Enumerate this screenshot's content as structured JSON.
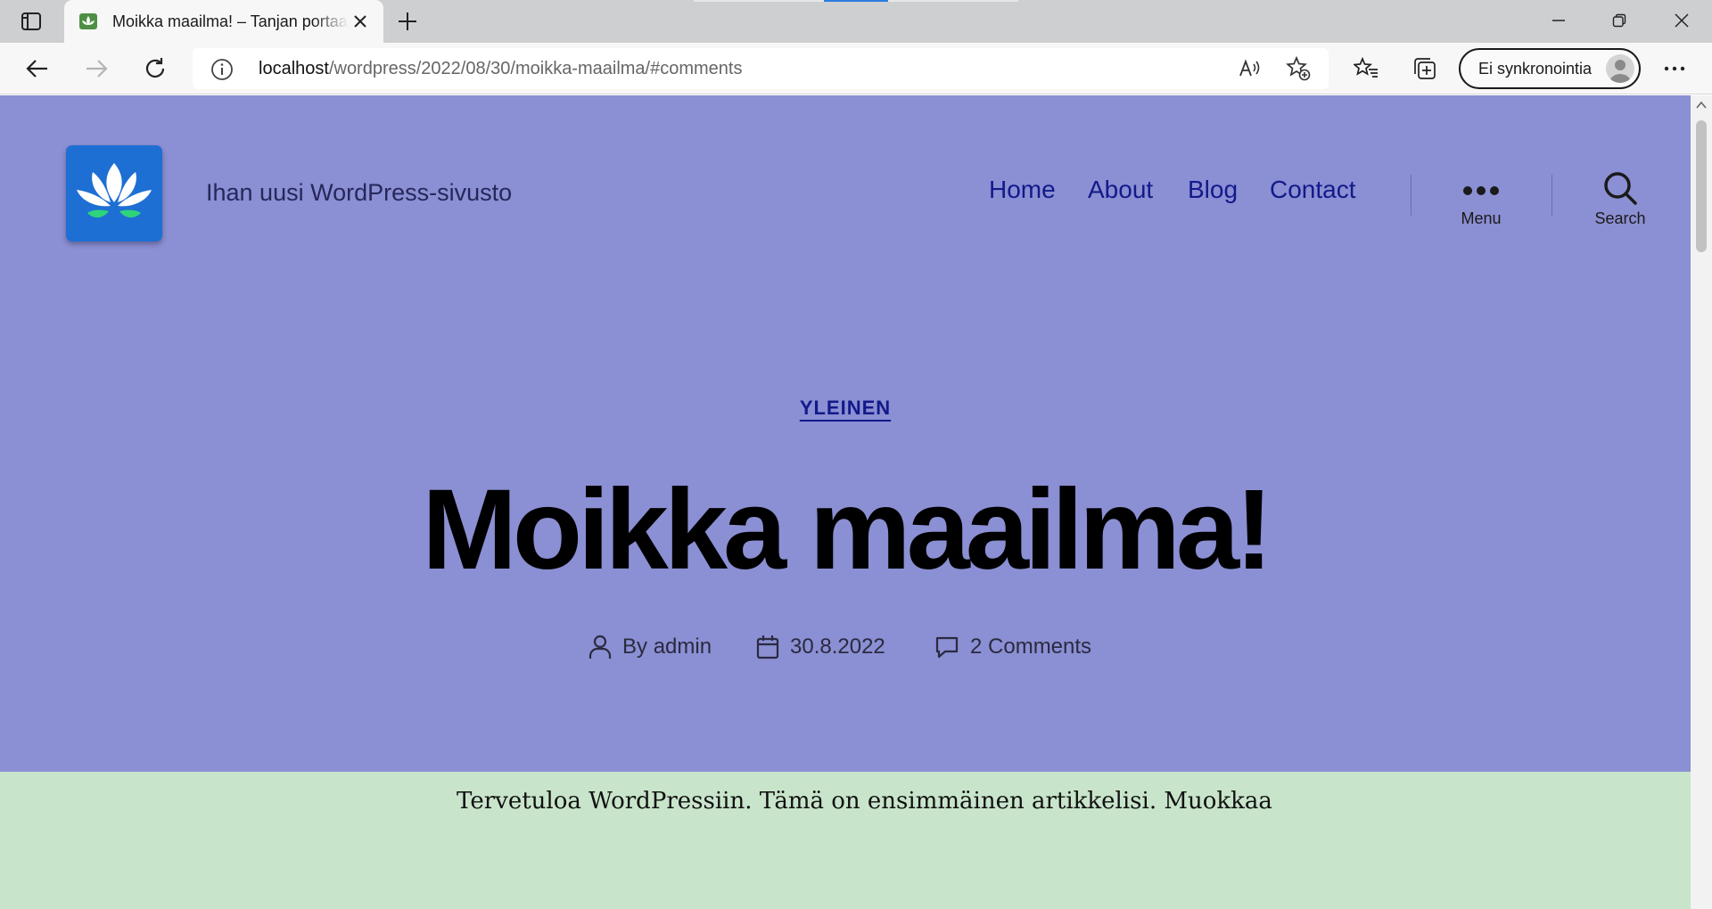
{
  "browser": {
    "tab_title": "Moikka maailma! – Tanjan portaali",
    "address": {
      "host": "localhost",
      "path": "/wordpress/2022/08/30/moikka-maailma/#comments"
    },
    "profile_label": "Ei synkronointia"
  },
  "site": {
    "title": "Ihan uusi WordPress-sivusto",
    "nav": [
      "Home",
      "About",
      "Blog",
      "Contact"
    ],
    "menu_label": "Menu",
    "search_label": "Search"
  },
  "post": {
    "category": "YLEINEN",
    "title": "Moikka maailma!",
    "author_prefix": "By ",
    "author": "admin",
    "date": "30.8.2022",
    "comments": "2 Comments",
    "excerpt": "Tervetuloa WordPressiin. Tämä on ensimmäinen artikkelisi. Muokkaa"
  },
  "colors": {
    "hero_bg": "#8b8fd3",
    "content_bg": "#c8e5cb",
    "accent": "#121a8a",
    "logo_bg": "#1e6fd4"
  }
}
